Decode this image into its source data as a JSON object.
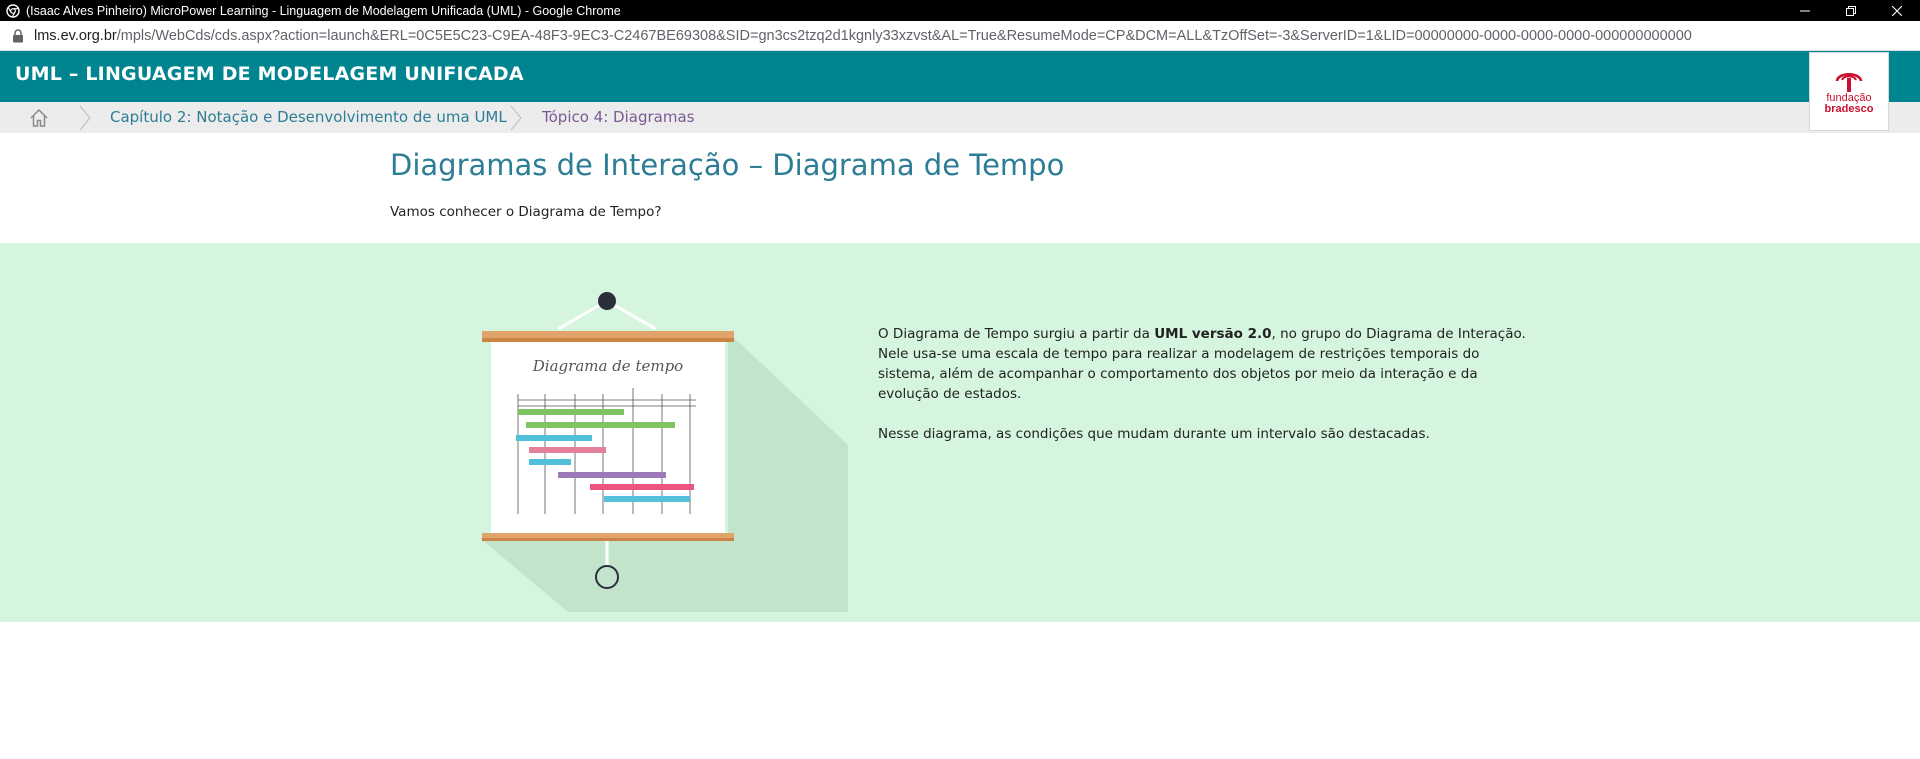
{
  "window": {
    "title": "(Isaac Alves Pinheiro) MicroPower Learning - Linguagem de Modelagem Unificada (UML) - Google Chrome",
    "controls": [
      "minimize-icon",
      "restore-icon",
      "close-icon"
    ]
  },
  "address": {
    "host": "lms.ev.org.br",
    "path": "/mpls/WebCds/cds.aspx?action=launch&ERL=0C5E5C23-C9EA-48F3-9EC3-C2467BE69308&SID=gn3cs2tzq2d1kgnly33xzvst&AL=True&ResumeMode=CP&DCM=ALL&TzOffSet=-3&ServerID=1&LID=00000000-0000-0000-0000-000000000000"
  },
  "header": {
    "title": "UML – LINGUAGEM DE MODELAGEM UNIFICADA",
    "logo_line1": "fundação",
    "logo_line2": "bradesco"
  },
  "breadcrumb": {
    "chapter": "Capítulo 2: Notação e Desenvolvimento de uma UML",
    "topic": "Tópico 4: Diagramas"
  },
  "main": {
    "title": "Diagramas de Interação – Diagrama de Tempo",
    "intro": "Vamos conhecer o Diagrama de Tempo?",
    "illustration_title": "Diagrama de tempo",
    "paragraph1_before": "O Diagrama de Tempo surgiu a partir da ",
    "paragraph1_bold": "UML versão 2.0",
    "paragraph1_after": ", no grupo do Diagrama de Interação. Nele usa-se uma escala de tempo para realizar a modelagem de restrições temporais do sistema, além de acompanhar o comportamento dos objetos por meio da interação e da evolução de estados.",
    "paragraph2": "Nesse diagrama, as condições que mudam durante um intervalo são destacadas."
  },
  "colors": {
    "header_bg": "#008490",
    "band_bg": "#d5f5de",
    "title_color": "#2c7d95",
    "topic_color": "#7a5a95",
    "logo_red": "#c8102e"
  }
}
